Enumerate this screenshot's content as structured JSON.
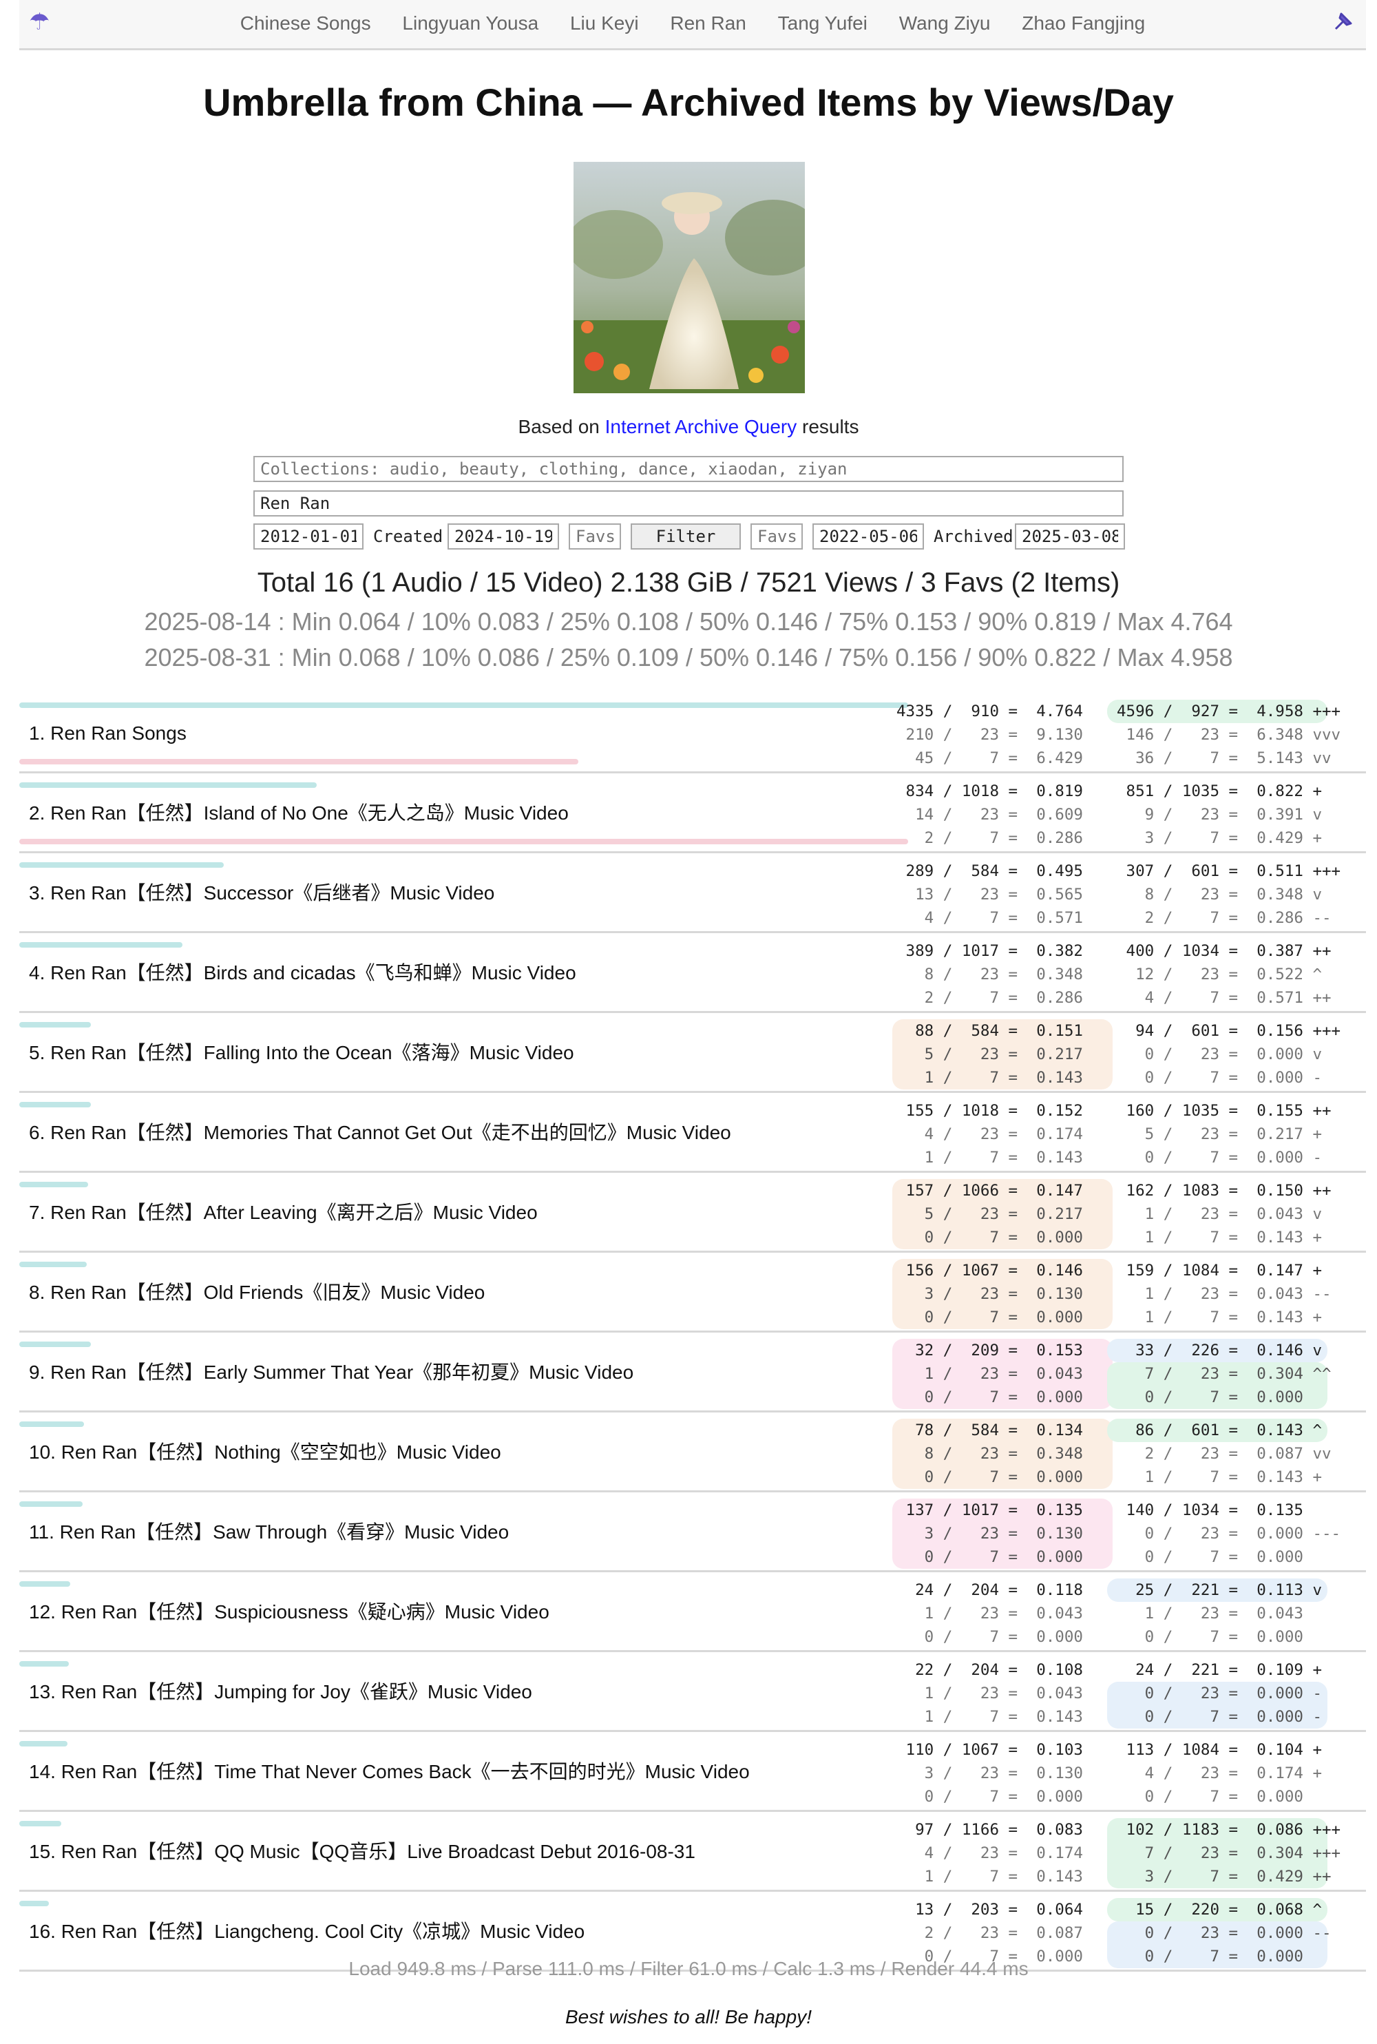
{
  "nav": {
    "left_icon": "umbrella-icon",
    "right_icon": "pin-icon",
    "links": [
      "Chinese Songs",
      "Lingyuan Yousa",
      "Liu Keyi",
      "Ren Ran",
      "Tang Yufei",
      "Wang Ziyu",
      "Zhao Fangjing"
    ]
  },
  "page_title": "Umbrella from China — Archived Items by Views/Day",
  "based_on": {
    "prefix": "Based on",
    "link": "Internet Archive Query",
    "suffix": "results"
  },
  "filters": {
    "collections_placeholder": "Collections: audio, beauty, clothing, dance, xiaodan, ziyan",
    "query_value": "Ren Ran",
    "created_from": "2012-01-01",
    "created_label": "Created",
    "created_to": "2024-10-19",
    "favs_left": "Favs",
    "filter_button": "Filter",
    "favs_right": "Favs",
    "archived_from": "2022-05-06",
    "archived_label": "Archived",
    "archived_to": "2025-03-08"
  },
  "summary": {
    "total": "Total 16 (1 Audio / 15 Video) 2.138 GiB / 7521 Views / 3 Favs (2 Items)",
    "stats1": "2025-08-14 : Min 0.064 / 10% 0.083 / 25% 0.108 / 50% 0.146 / 75% 0.153 / 90% 0.819 / Max 4.764",
    "stats2": "2025-08-31 : Min 0.068 / 10% 0.086 / 25% 0.109 / 50% 0.146 / 75% 0.156 / 90% 0.822 / Max 4.958"
  },
  "colors": {
    "teal_bar": "#bfe6e6",
    "pink_bar": "#f6d0d8",
    "peach": "#fbeee3",
    "pink": "#fce6f0",
    "green": "#e0f5e8",
    "blue": "#e6f0fa",
    "link": "#1a1aff"
  },
  "items": [
    {
      "title": "1. Ren Ran Songs",
      "bar_top": 0.66,
      "bar_bottom": 0.415,
      "a": [
        "4335 /  910 =  4.764",
        "210 /   23 =  9.130",
        "45 /    7 =  6.429"
      ],
      "a_bg": "",
      "b": [
        "4596 /  927 =  4.958 +++",
        "146 /   23 =  6.348 vvv",
        "36 /    7 =  5.143 vv"
      ],
      "b_bg": [
        "g",
        "",
        ""
      ]
    },
    {
      "title": "2. Ren Ran【任然】Island of No One《无人之岛》Music Video",
      "bar_top": 0.221,
      "bar_bottom": 0.66,
      "a": [
        "834 / 1018 =  0.819",
        "14 /   23 =  0.609",
        "2 /    7 =  0.286"
      ],
      "a_bg": "",
      "b": [
        "851 / 1035 =  0.822 +",
        "9 /   23 =  0.391 v",
        "3 /    7 =  0.429 +"
      ],
      "b_bg": [
        "",
        "",
        ""
      ]
    },
    {
      "title": "3. Ren Ran【任然】Successor《后继者》Music Video",
      "bar_top": 0.152,
      "bar_bottom": 0,
      "a": [
        "289 /  584 =  0.495",
        "13 /   23 =  0.565",
        "4 /    7 =  0.571"
      ],
      "a_bg": "",
      "b": [
        "307 /  601 =  0.511 +++",
        "8 /   23 =  0.348 v",
        "2 /    7 =  0.286 --"
      ],
      "b_bg": [
        "",
        "",
        ""
      ]
    },
    {
      "title": "4. Ren Ran【任然】Birds and cicadas《飞鸟和蝉》Music Video",
      "bar_top": 0.121,
      "bar_bottom": 0,
      "a": [
        "389 / 1017 =  0.382",
        "8 /   23 =  0.348",
        "2 /    7 =  0.286"
      ],
      "a_bg": "",
      "b": [
        "400 / 1034 =  0.387 ++",
        "12 /   23 =  0.522 ^",
        "4 /    7 =  0.571 ++"
      ],
      "b_bg": [
        "",
        "",
        ""
      ]
    },
    {
      "title": "5. Ren Ran【任然】Falling Into the Ocean《落海》Music Video",
      "bar_top": 0.053,
      "bar_bottom": 0,
      "a": [
        "88 /  584 =  0.151",
        "5 /   23 =  0.217",
        "1 /    7 =  0.143"
      ],
      "a_bg": "p",
      "b": [
        "94 /  601 =  0.156 +++",
        "0 /   23 =  0.000 v",
        "0 /    7 =  0.000 -"
      ],
      "b_bg": [
        "",
        "",
        ""
      ]
    },
    {
      "title": "6. Ren Ran【任然】Memories That Cannot Get Out《走不出的回忆》Music Video",
      "bar_top": 0.053,
      "bar_bottom": 0,
      "a": [
        "155 / 1018 =  0.152",
        "4 /   23 =  0.174",
        "1 /    7 =  0.143"
      ],
      "a_bg": "",
      "b": [
        "160 / 1035 =  0.155 ++",
        "5 /   23 =  0.217 +",
        "0 /    7 =  0.000 -"
      ],
      "b_bg": [
        "",
        "",
        ""
      ]
    },
    {
      "title": "7. Ren Ran【任然】After Leaving《离开之后》Music Video",
      "bar_top": 0.051,
      "bar_bottom": 0,
      "a": [
        "157 / 1066 =  0.147",
        "5 /   23 =  0.217",
        "0 /    7 =  0.000"
      ],
      "a_bg": "p",
      "b": [
        "162 / 1083 =  0.150 ++",
        "1 /   23 =  0.043 v",
        "1 /    7 =  0.143 +"
      ],
      "b_bg": [
        "",
        "",
        ""
      ]
    },
    {
      "title": "8. Ren Ran【任然】Old Friends《旧友》Music Video",
      "bar_top": 0.05,
      "bar_bottom": 0,
      "a": [
        "156 / 1067 =  0.146",
        "3 /   23 =  0.130",
        "0 /    7 =  0.000"
      ],
      "a_bg": "p",
      "b": [
        "159 / 1084 =  0.147 +",
        "1 /   23 =  0.043 --",
        "1 /    7 =  0.143 +"
      ],
      "b_bg": [
        "",
        "",
        ""
      ]
    },
    {
      "title": "9. Ren Ran【任然】Early Summer That Year《那年初夏》Music Video",
      "bar_top": 0.053,
      "bar_bottom": 0,
      "a": [
        "32 /  209 =  0.153",
        "1 /   23 =  0.043",
        "0 /    7 =  0.000"
      ],
      "a_bg": "pink",
      "b": [
        "33 /  226 =  0.146 v",
        "7 /   23 =  0.304 ^^",
        "0 /    7 =  0.000"
      ],
      "b_bg": [
        "b",
        "g",
        "g"
      ]
    },
    {
      "title": "10. Ren Ran【任然】Nothing《空空如也》Music Video",
      "bar_top": 0.048,
      "bar_bottom": 0,
      "a": [
        "78 /  584 =  0.134",
        "8 /   23 =  0.348",
        "0 /    7 =  0.000"
      ],
      "a_bg": "p",
      "b": [
        "86 /  601 =  0.143 ^",
        "2 /   23 =  0.087 vv",
        "1 /    7 =  0.143 +"
      ],
      "b_bg": [
        "g",
        "",
        ""
      ]
    },
    {
      "title": "11. Ren Ran【任然】Saw Through《看穿》Music Video",
      "bar_top": 0.047,
      "bar_bottom": 0,
      "a": [
        "137 / 1017 =  0.135",
        "3 /   23 =  0.130",
        "0 /    7 =  0.000"
      ],
      "a_bg": "pink",
      "b": [
        "140 / 1034 =  0.135",
        "0 /   23 =  0.000 ---",
        "0 /    7 =  0.000"
      ],
      "b_bg": [
        "",
        "",
        ""
      ]
    },
    {
      "title": "12. Ren Ran【任然】Suspiciousness《疑心病》Music Video",
      "bar_top": 0.038,
      "bar_bottom": 0,
      "a": [
        "24 /  204 =  0.118",
        "1 /   23 =  0.043",
        "0 /    7 =  0.000"
      ],
      "a_bg": "",
      "b": [
        "25 /  221 =  0.113 v",
        "1 /   23 =  0.043",
        "0 /    7 =  0.000"
      ],
      "b_bg": [
        "b",
        "",
        ""
      ]
    },
    {
      "title": "13. Ren Ran【任然】Jumping for Joy《雀跃》Music Video",
      "bar_top": 0.037,
      "bar_bottom": 0,
      "a": [
        "22 /  204 =  0.108",
        "1 /   23 =  0.043",
        "1 /    7 =  0.143"
      ],
      "a_bg": "",
      "b": [
        "24 /  221 =  0.109 +",
        "0 /   23 =  0.000 -",
        "0 /    7 =  0.000 -"
      ],
      "b_bg": [
        "",
        "b",
        "b"
      ]
    },
    {
      "title": "14. Ren Ran【任然】Time That Never Comes Back《一去不回的时光》Music Video",
      "bar_top": 0.036,
      "bar_bottom": 0,
      "a": [
        "110 / 1067 =  0.103",
        "3 /   23 =  0.130",
        "0 /    7 =  0.000"
      ],
      "a_bg": "",
      "b": [
        "113 / 1084 =  0.104 +",
        "4 /   23 =  0.174 +",
        "0 /    7 =  0.000"
      ],
      "b_bg": [
        "",
        "",
        ""
      ]
    },
    {
      "title": "15. Ren Ran【任然】QQ Music【QQ音乐】Live Broadcast Debut 2016-08-31",
      "bar_top": 0.031,
      "bar_bottom": 0,
      "a": [
        "97 / 1166 =  0.083",
        "4 /   23 =  0.174",
        "1 /    7 =  0.143"
      ],
      "a_bg": "",
      "b": [
        "102 / 1183 =  0.086 +++",
        "7 /   23 =  0.304 +++",
        "3 /    7 =  0.429 ++"
      ],
      "b_bg": [
        "g",
        "g",
        "g"
      ]
    },
    {
      "title": "16. Ren Ran【任然】Liangcheng. Cool City《凉城》Music Video",
      "bar_top": 0.022,
      "bar_bottom": 0,
      "a": [
        "13 /  203 =  0.064",
        "2 /   23 =  0.087",
        "0 /    7 =  0.000"
      ],
      "a_bg": "",
      "b": [
        "15 /  220 =  0.068 ^",
        "0 /   23 =  0.000 --",
        "0 /    7 =  0.000"
      ],
      "b_bg": [
        "g",
        "b",
        "b"
      ]
    }
  ],
  "footer": "Load 949.8 ms / Parse 111.0 ms / Filter 61.0 ms / Calc 1.3 ms / Render 44.4 ms",
  "wish": "Best wishes to all! Be happy!"
}
